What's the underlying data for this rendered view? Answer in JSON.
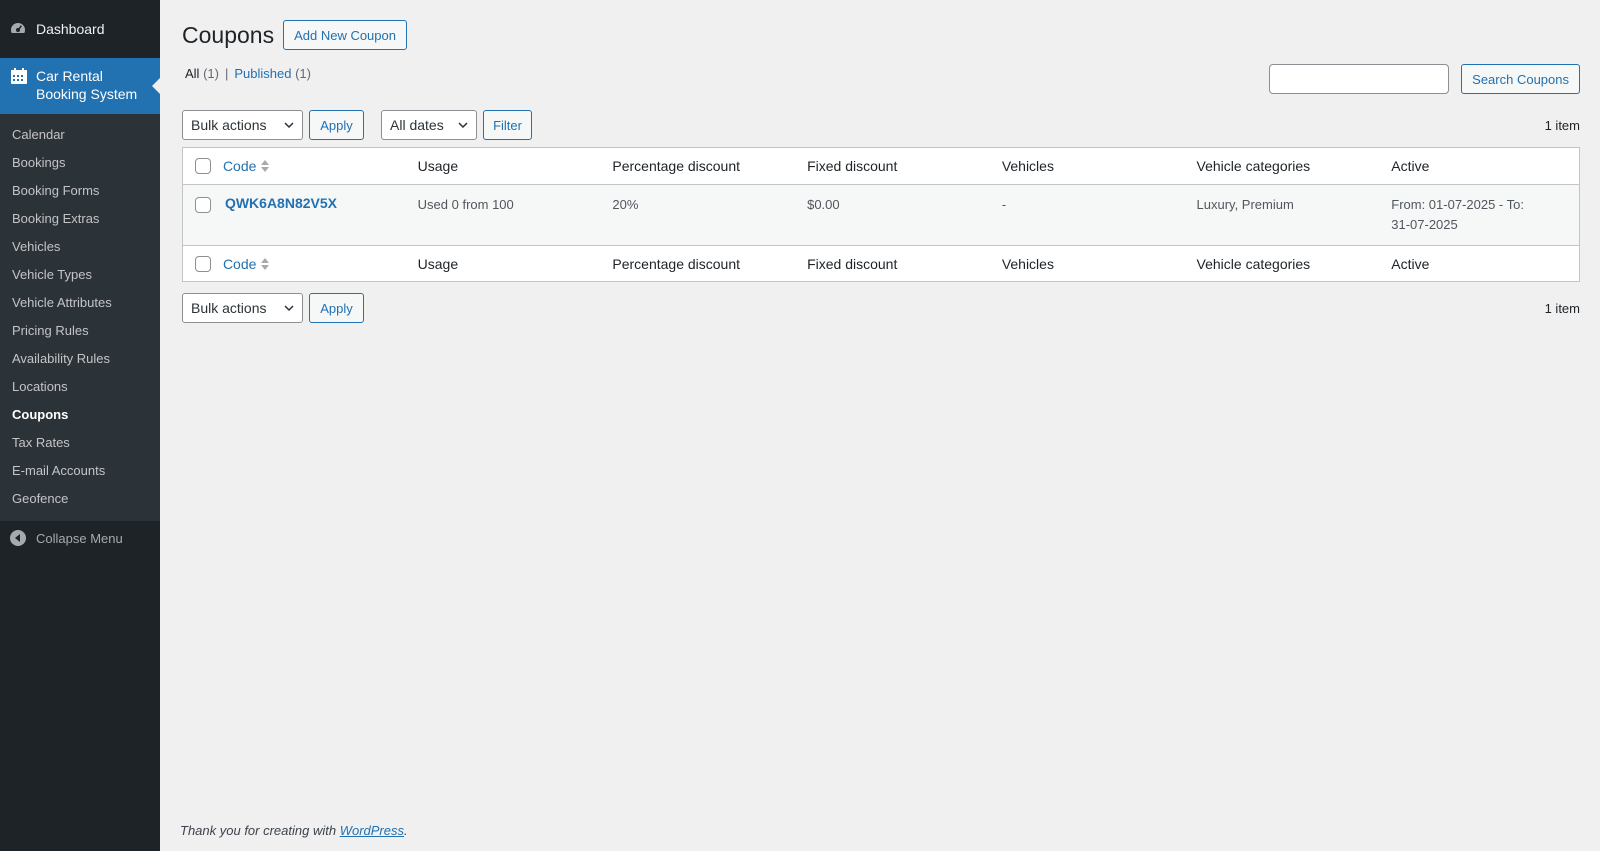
{
  "sidebar": {
    "dashboard_label": "Dashboard",
    "plugin_label_line1": "Car Rental",
    "plugin_label_line2": "Booking System",
    "items": [
      {
        "label": "Calendar"
      },
      {
        "label": "Bookings"
      },
      {
        "label": "Booking Forms"
      },
      {
        "label": "Booking Extras"
      },
      {
        "label": "Vehicles"
      },
      {
        "label": "Vehicle Types"
      },
      {
        "label": "Vehicle Attributes"
      },
      {
        "label": "Pricing Rules"
      },
      {
        "label": "Availability Rules"
      },
      {
        "label": "Locations"
      },
      {
        "label": "Coupons",
        "current": true
      },
      {
        "label": "Tax Rates"
      },
      {
        "label": "E-mail Accounts"
      },
      {
        "label": "Geofence"
      }
    ],
    "collapse_label": "Collapse Menu"
  },
  "header": {
    "title": "Coupons",
    "add_new_label": "Add New Coupon"
  },
  "filters": {
    "all_label": "All",
    "all_count": "(1)",
    "published_label": "Published",
    "published_count": "(1)"
  },
  "search": {
    "value": "",
    "button_label": "Search Coupons"
  },
  "tablenav_top": {
    "bulk_actions": "Bulk actions",
    "apply_label": "Apply",
    "dates_select": "All dates",
    "filter_label": "Filter",
    "items_count": "1 item"
  },
  "tablenav_bottom": {
    "bulk_actions": "Bulk actions",
    "apply_label": "Apply",
    "items_count": "1 item"
  },
  "table": {
    "columns": [
      "Code",
      "Usage",
      "Percentage discount",
      "Fixed discount",
      "Vehicles",
      "Vehicle categories",
      "Active"
    ],
    "rows": [
      {
        "code": "QWK6A8N82V5X",
        "usage": "Used 0 from 100",
        "percentage": "20%",
        "fixed": "$0.00",
        "vehicles": "-",
        "categories": "Luxury, Premium",
        "active_line1": "From: 01-07-2025 - To:",
        "active_line2": "31-07-2025"
      }
    ]
  },
  "footer": {
    "text": "Thank you for creating with",
    "link": "WordPress",
    "suffix": "."
  },
  "colors": {
    "sidebar_bg": "#1d2327",
    "accent": "#2271b1",
    "page_bg": "#f0f0f1"
  }
}
